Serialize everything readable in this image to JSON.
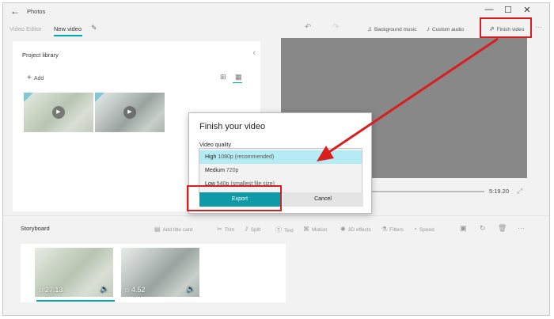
{
  "window": {
    "back_icon": "←",
    "app_title": "Photos",
    "minimize_icon": "—",
    "maximize_icon": "☐",
    "close_icon": "✕"
  },
  "breadcrumb": {
    "video_editor": "Video Editor",
    "project_name": "New video",
    "edit_icon": "✎"
  },
  "toolbar": {
    "undo_icon": "↶",
    "redo_icon": "↷",
    "background_music": "Background music",
    "custom_audio": "Custom audio",
    "finish_video": "Finish video",
    "more_icon": "···",
    "music_icon": "♫",
    "audio_icon": "♪",
    "share_icon": "⇗"
  },
  "library": {
    "title": "Project library",
    "add_label": "Add",
    "add_icon": "+",
    "collapse_icon": "‹",
    "grid_large_icon": "⊞",
    "grid_small_icon": "▦"
  },
  "player": {
    "time": "5:19.20",
    "fullscreen_icon": "⤢"
  },
  "storyboard": {
    "title": "Storyboard",
    "tools": [
      "Add title card",
      "Trim",
      "Split",
      "Text",
      "Motion",
      "3D effects",
      "Filters",
      "Speed"
    ],
    "tool_icons": [
      "▤",
      "✂",
      "⫽",
      "Ⓣ",
      "⌘",
      "✺",
      "⚗",
      "◔"
    ],
    "crop_icon": "▣",
    "trash_icon": "🗑",
    "more_icon": "···",
    "clips": [
      {
        "duration": "27.13",
        "duration_icon": "□",
        "volume_icon": "🔈"
      },
      {
        "duration": "4.52",
        "duration_icon": "□",
        "volume_icon": "🔈"
      }
    ]
  },
  "dialog": {
    "title": "Finish your video",
    "quality_label": "Video quality",
    "options": [
      {
        "level": "High",
        "detail": "1080p (recommended)"
      },
      {
        "level": "Medium",
        "detail": "720p"
      },
      {
        "level": "Low",
        "detail": "540p (smallest file size)"
      }
    ],
    "selected_option": "High 1080p (recommended)",
    "export_label": "Export",
    "cancel_label": "Cancel"
  },
  "annotation_color": "#d81e1e",
  "accent_color": "#0e9aa7"
}
